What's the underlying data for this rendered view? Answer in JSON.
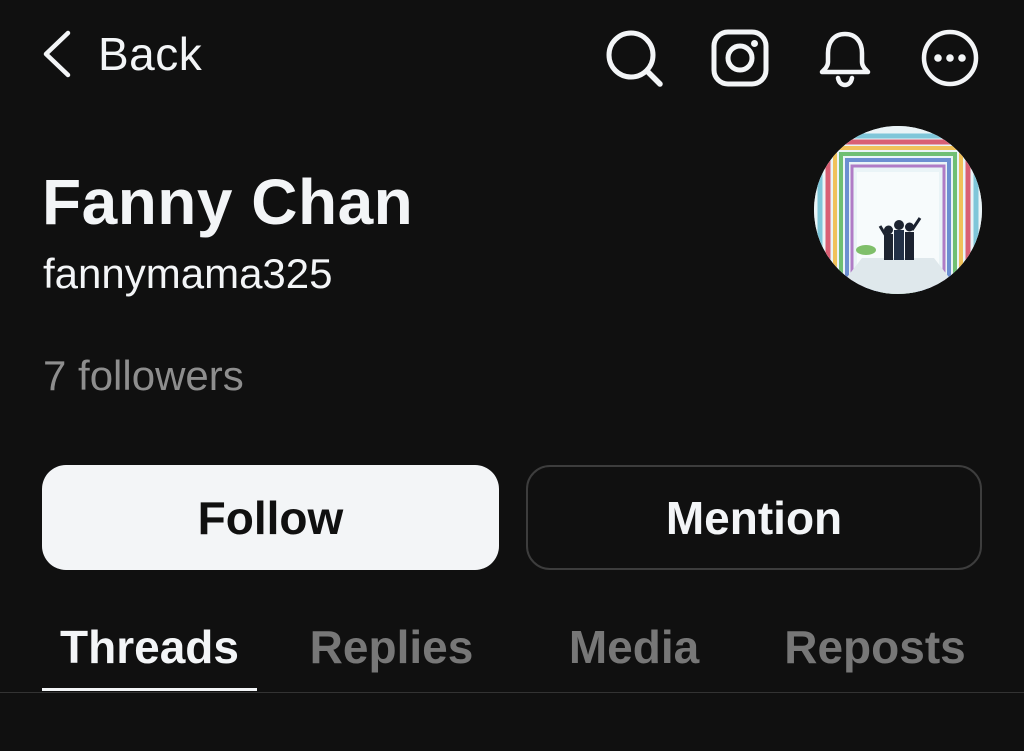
{
  "header": {
    "back_label": "Back",
    "icons": [
      "search-icon",
      "instagram-icon",
      "bell-icon",
      "more-icon"
    ]
  },
  "profile": {
    "name": "Fanny Chan",
    "handle": "fannymama325",
    "followers": "7 followers",
    "avatar": "profile-photo"
  },
  "actions": {
    "follow_label": "Follow",
    "mention_label": "Mention"
  },
  "tabs": [
    {
      "label": "Threads",
      "active": true
    },
    {
      "label": "Replies",
      "active": false
    },
    {
      "label": "Media",
      "active": false
    },
    {
      "label": "Reposts",
      "active": false
    }
  ],
  "colors": {
    "background": "#101010",
    "text_primary": "#f3f5f7",
    "text_secondary": "#8e8e8e",
    "tab_inactive": "#777777",
    "follow_button_bg": "#f3f5f7",
    "border": "#3d3d3d"
  }
}
